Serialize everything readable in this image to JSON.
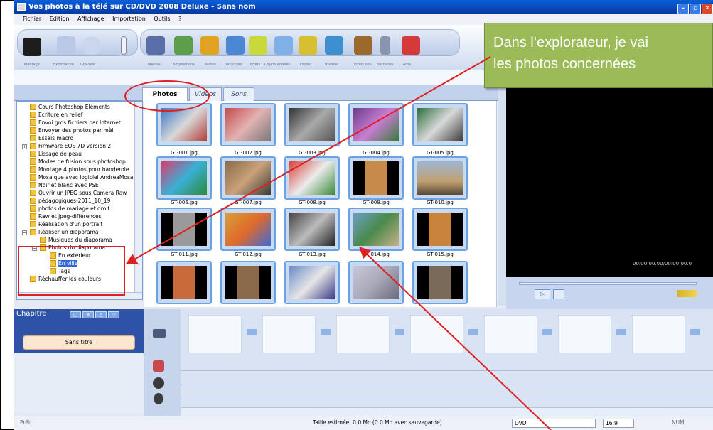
{
  "window": {
    "title": "Vos photos à la télé sur CD/DVD 2008 Deluxe - Sans nom"
  },
  "menu": [
    "Fichier",
    "Edition",
    "Affichage",
    "Importation",
    "Outils",
    "?"
  ],
  "toolbar_labels": [
    "Montage",
    "Exportation",
    "Gravure",
    "Medias",
    "Compositions",
    "Textes",
    "Transitions",
    "Effets",
    "Objets Animés",
    "Filtres",
    "Thèmes",
    "Effets son",
    "Narration",
    "Aide"
  ],
  "tabs": [
    {
      "label": "Photos",
      "active": true
    },
    {
      "label": "Vidéos",
      "active": false
    },
    {
      "label": "Sons",
      "active": false
    }
  ],
  "tree": [
    {
      "label": "Cours Photoshop Eléments"
    },
    {
      "label": "Ecriture en relief"
    },
    {
      "label": "Envoi gros fichiers par Internet"
    },
    {
      "label": "Envoyer des photos par mèl"
    },
    {
      "label": "Essais macro"
    },
    {
      "label": "Firmware EOS 7D version 2"
    },
    {
      "label": "Lissage de peau"
    },
    {
      "label": "Modes de fusion sous photoshop"
    },
    {
      "label": "Montage 4 photos pour banderole"
    },
    {
      "label": "Mosaique avec logiciel AndreaMosa"
    },
    {
      "label": "Noir et blanc avec PSE"
    },
    {
      "label": "Ouvrir un JPEG sous Caméra Raw"
    },
    {
      "label": "pédagogiques-2011_10_19"
    },
    {
      "label": "photos de mariage et droit"
    },
    {
      "label": "Raw et jpeg-différences"
    },
    {
      "label": "Réalisation d'un portrait"
    },
    {
      "label": "Réaliser un diaporama"
    },
    {
      "label": "Musiques du diaporama"
    },
    {
      "label": "Photos du diaporama"
    },
    {
      "label": "En extérieur"
    },
    {
      "label": "En ville"
    },
    {
      "label": "Tags"
    },
    {
      "label": "Réchauffer les couleurs"
    }
  ],
  "photos": [
    "GT-001.jpg",
    "GT-002.jpg",
    "GT-003.jpg",
    "GT-004.jpg",
    "GT-005.jpg",
    "GT-006.jpg",
    "GT-007.jpg",
    "GT-008.jpg",
    "GT-009.jpg",
    "GT-010.jpg",
    "GT-011.jpg",
    "GT-012.jpg",
    "GT-013.jpg",
    "GT-014.jpg",
    "GT-015.jpg",
    "",
    "",
    "",
    "",
    ""
  ],
  "preview": {
    "timecode": "00:00:00.00/00:00:00.0"
  },
  "chapitre": {
    "title": "Chapitre",
    "item": "Sans titre"
  },
  "status": {
    "left": "Prêt",
    "center": "Taille estimée: 0.0 Mo  (0.0 Mo avec sauvegarde)",
    "format": "DVD",
    "ratio": "16:9",
    "num": "NUM"
  },
  "callout": {
    "line1": "Dans l’explorateur, je vai",
    "line2": "les photos concernées"
  },
  "colors": {
    "callout": "#9bbb59",
    "annotation": "#e02020",
    "titlebar": "#0a5fd8"
  }
}
